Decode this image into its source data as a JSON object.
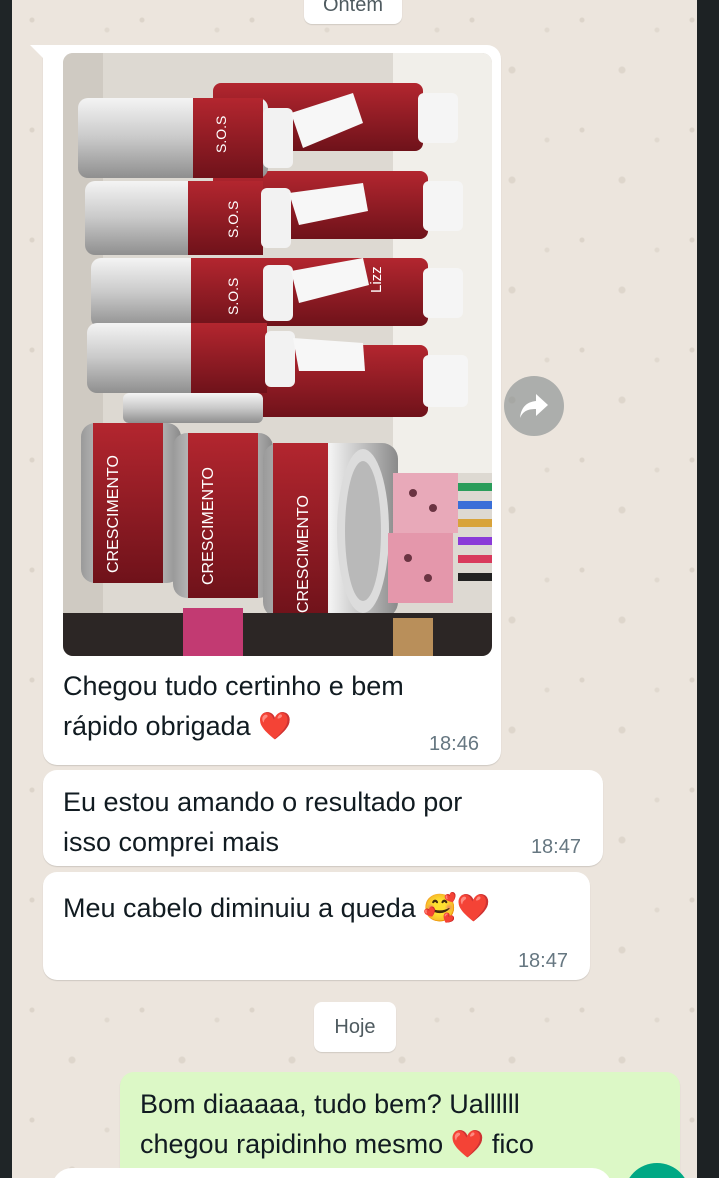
{
  "day_separators": {
    "yesterday": "Ontem",
    "today": "Hoje"
  },
  "messages": [
    {
      "text_line1": "Chegou tudo certinho e bem",
      "text_line2": "rápido obrigada",
      "emoji": "❤️",
      "time": "18:46"
    },
    {
      "text_line1": "Eu estou amando o resultado por",
      "text_line2": "isso comprei mais",
      "time": "18:47"
    },
    {
      "text": "Meu cabelo diminuiu a queda",
      "emoji": "🥰❤️",
      "time": "18:47"
    },
    {
      "text_line1": "Bom diaaaaa, tudo bem? Uallllll",
      "text_line2": "chegou rapidinho mesmo",
      "emoji": "❤️",
      "text_after": "fico"
    }
  ],
  "product_photo": {
    "brand": "Lizz Ante",
    "labels": [
      "S.O.S",
      "CRESCIMENTO",
      "CRESCIMENTO",
      "CRESCIMENTO"
    ]
  },
  "icons": {
    "forward": "forward-icon"
  },
  "colors": {
    "incoming_bubble": "#ffffff",
    "outgoing_bubble": "#dcf8c6",
    "chat_bg": "#ece5dd",
    "accent": "#00a884"
  }
}
